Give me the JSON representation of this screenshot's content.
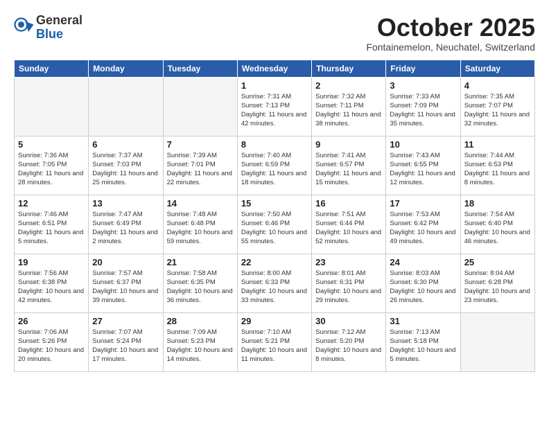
{
  "header": {
    "logo_general": "General",
    "logo_blue": "Blue",
    "month_title": "October 2025",
    "location": "Fontainemelon, Neuchatel, Switzerland"
  },
  "days_of_week": [
    "Sunday",
    "Monday",
    "Tuesday",
    "Wednesday",
    "Thursday",
    "Friday",
    "Saturday"
  ],
  "weeks": [
    [
      {
        "day": "",
        "empty": true
      },
      {
        "day": "",
        "empty": true
      },
      {
        "day": "",
        "empty": true
      },
      {
        "day": "1",
        "sunrise": "7:31 AM",
        "sunset": "7:13 PM",
        "daylight": "11 hours and 42 minutes."
      },
      {
        "day": "2",
        "sunrise": "7:32 AM",
        "sunset": "7:11 PM",
        "daylight": "11 hours and 38 minutes."
      },
      {
        "day": "3",
        "sunrise": "7:33 AM",
        "sunset": "7:09 PM",
        "daylight": "11 hours and 35 minutes."
      },
      {
        "day": "4",
        "sunrise": "7:35 AM",
        "sunset": "7:07 PM",
        "daylight": "11 hours and 32 minutes."
      }
    ],
    [
      {
        "day": "5",
        "sunrise": "7:36 AM",
        "sunset": "7:05 PM",
        "daylight": "11 hours and 28 minutes."
      },
      {
        "day": "6",
        "sunrise": "7:37 AM",
        "sunset": "7:03 PM",
        "daylight": "11 hours and 25 minutes."
      },
      {
        "day": "7",
        "sunrise": "7:39 AM",
        "sunset": "7:01 PM",
        "daylight": "11 hours and 22 minutes."
      },
      {
        "day": "8",
        "sunrise": "7:40 AM",
        "sunset": "6:59 PM",
        "daylight": "11 hours and 18 minutes."
      },
      {
        "day": "9",
        "sunrise": "7:41 AM",
        "sunset": "6:57 PM",
        "daylight": "11 hours and 15 minutes."
      },
      {
        "day": "10",
        "sunrise": "7:43 AM",
        "sunset": "6:55 PM",
        "daylight": "11 hours and 12 minutes."
      },
      {
        "day": "11",
        "sunrise": "7:44 AM",
        "sunset": "6:53 PM",
        "daylight": "11 hours and 8 minutes."
      }
    ],
    [
      {
        "day": "12",
        "sunrise": "7:46 AM",
        "sunset": "6:51 PM",
        "daylight": "11 hours and 5 minutes."
      },
      {
        "day": "13",
        "sunrise": "7:47 AM",
        "sunset": "6:49 PM",
        "daylight": "11 hours and 2 minutes."
      },
      {
        "day": "14",
        "sunrise": "7:48 AM",
        "sunset": "6:48 PM",
        "daylight": "10 hours and 59 minutes."
      },
      {
        "day": "15",
        "sunrise": "7:50 AM",
        "sunset": "6:46 PM",
        "daylight": "10 hours and 55 minutes."
      },
      {
        "day": "16",
        "sunrise": "7:51 AM",
        "sunset": "6:44 PM",
        "daylight": "10 hours and 52 minutes."
      },
      {
        "day": "17",
        "sunrise": "7:53 AM",
        "sunset": "6:42 PM",
        "daylight": "10 hours and 49 minutes."
      },
      {
        "day": "18",
        "sunrise": "7:54 AM",
        "sunset": "6:40 PM",
        "daylight": "10 hours and 46 minutes."
      }
    ],
    [
      {
        "day": "19",
        "sunrise": "7:56 AM",
        "sunset": "6:38 PM",
        "daylight": "10 hours and 42 minutes."
      },
      {
        "day": "20",
        "sunrise": "7:57 AM",
        "sunset": "6:37 PM",
        "daylight": "10 hours and 39 minutes."
      },
      {
        "day": "21",
        "sunrise": "7:58 AM",
        "sunset": "6:35 PM",
        "daylight": "10 hours and 36 minutes."
      },
      {
        "day": "22",
        "sunrise": "8:00 AM",
        "sunset": "6:33 PM",
        "daylight": "10 hours and 33 minutes."
      },
      {
        "day": "23",
        "sunrise": "8:01 AM",
        "sunset": "6:31 PM",
        "daylight": "10 hours and 29 minutes."
      },
      {
        "day": "24",
        "sunrise": "8:03 AM",
        "sunset": "6:30 PM",
        "daylight": "10 hours and 26 minutes."
      },
      {
        "day": "25",
        "sunrise": "8:04 AM",
        "sunset": "6:28 PM",
        "daylight": "10 hours and 23 minutes."
      }
    ],
    [
      {
        "day": "26",
        "sunrise": "7:06 AM",
        "sunset": "5:26 PM",
        "daylight": "10 hours and 20 minutes."
      },
      {
        "day": "27",
        "sunrise": "7:07 AM",
        "sunset": "5:24 PM",
        "daylight": "10 hours and 17 minutes."
      },
      {
        "day": "28",
        "sunrise": "7:09 AM",
        "sunset": "5:23 PM",
        "daylight": "10 hours and 14 minutes."
      },
      {
        "day": "29",
        "sunrise": "7:10 AM",
        "sunset": "5:21 PM",
        "daylight": "10 hours and 11 minutes."
      },
      {
        "day": "30",
        "sunrise": "7:12 AM",
        "sunset": "5:20 PM",
        "daylight": "10 hours and 8 minutes."
      },
      {
        "day": "31",
        "sunrise": "7:13 AM",
        "sunset": "5:18 PM",
        "daylight": "10 hours and 5 minutes."
      },
      {
        "day": "",
        "empty": true
      }
    ]
  ]
}
